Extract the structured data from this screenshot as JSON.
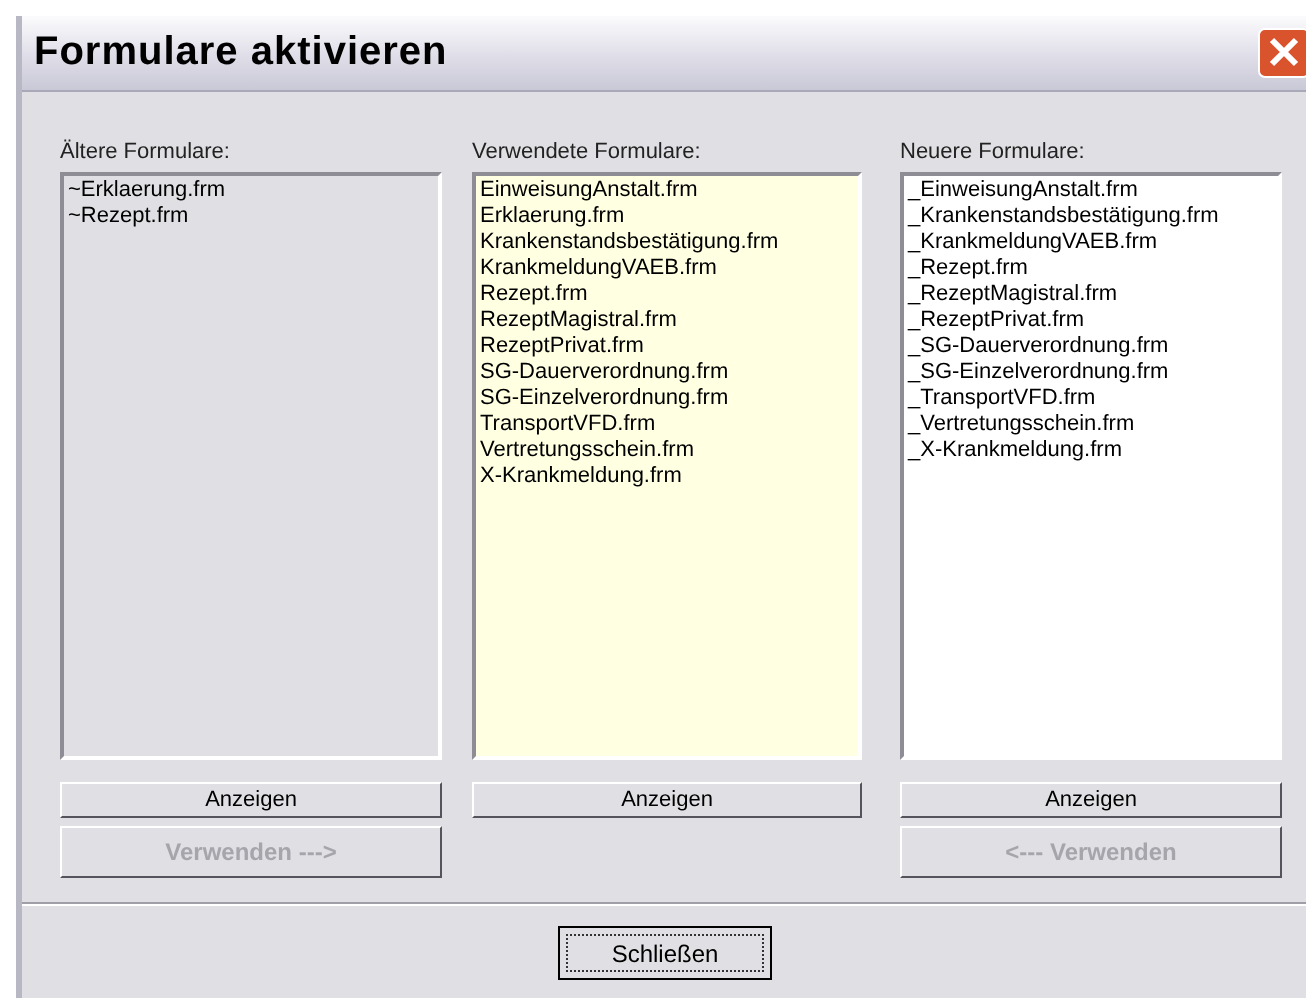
{
  "window": {
    "title": "Formulare aktivieren"
  },
  "panels": [
    {
      "label": "Ältere Formulare:",
      "kind": "older",
      "items": [
        "~Erklaerung.frm",
        "~Rezept.frm"
      ],
      "show_button": {
        "label": "Anzeigen",
        "disabled": false
      },
      "use_button": {
        "label": "Verwenden --->",
        "disabled": true
      }
    },
    {
      "label": "Verwendete Formulare:",
      "kind": "used",
      "items": [
        "EinweisungAnstalt.frm",
        "Erklaerung.frm",
        "Krankenstandsbestätigung.frm",
        "KrankmeldungVAEB.frm",
        "Rezept.frm",
        "RezeptMagistral.frm",
        "RezeptPrivat.frm",
        "SG-Dauerverordnung.frm",
        "SG-Einzelverordnung.frm",
        "TransportVFD.frm",
        "Vertretungsschein.frm",
        "X-Krankmeldung.frm"
      ],
      "show_button": {
        "label": "Anzeigen",
        "disabled": false
      }
    },
    {
      "label": "Neuere Formulare:",
      "kind": "newer",
      "items": [
        "_EinweisungAnstalt.frm",
        "_Krankenstandsbestätigung.frm",
        "_KrankmeldungVAEB.frm",
        "_Rezept.frm",
        "_RezeptMagistral.frm",
        "_RezeptPrivat.frm",
        "_SG-Dauerverordnung.frm",
        "_SG-Einzelverordnung.frm",
        "_TransportVFD.frm",
        "_Vertretungsschein.frm",
        "_X-Krankmeldung.frm"
      ],
      "show_button": {
        "label": "Anzeigen",
        "disabled": false
      },
      "use_button": {
        "label": "<---  Verwenden",
        "disabled": true
      }
    }
  ],
  "close_button": {
    "label": "Schließen"
  }
}
